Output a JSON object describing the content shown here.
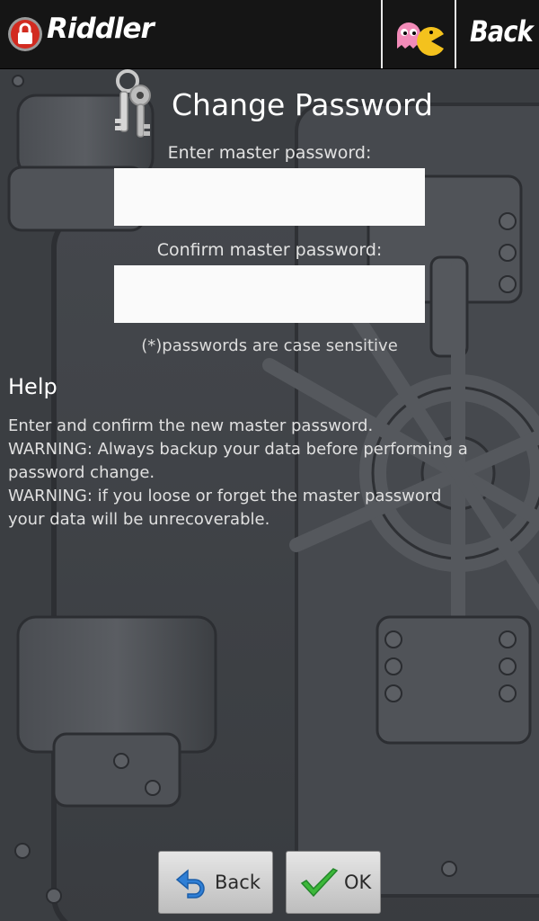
{
  "header": {
    "app_title": "Riddler",
    "back_label": "Back"
  },
  "main": {
    "title": "Change Password",
    "enter_label": "Enter master password:",
    "enter_value": "",
    "confirm_label": "Confirm master password:",
    "confirm_value": "",
    "case_hint": "(*)passwords are case sensitive"
  },
  "help": {
    "heading": "Help",
    "lines": [
      "Enter and confirm the new master password.",
      "WARNING: Always backup your data before performing a",
      "password change.",
      "WARNING: if you loose or forget the master password",
      "your data will be unrecoverable."
    ]
  },
  "footer": {
    "back_label": "Back",
    "ok_label": "OK"
  },
  "icons": {
    "logo": "lock-logo-icon",
    "game": "pacman-ghost-icon",
    "keys": "keys-icon",
    "back_arrow": "back-arrow-icon",
    "ok_check": "checkmark-icon"
  },
  "colors": {
    "topbar": "#151515",
    "background": "#3f4246",
    "logo_red": "#d22b20",
    "ok_green": "#3db83a",
    "back_blue": "#2f7fd6"
  }
}
